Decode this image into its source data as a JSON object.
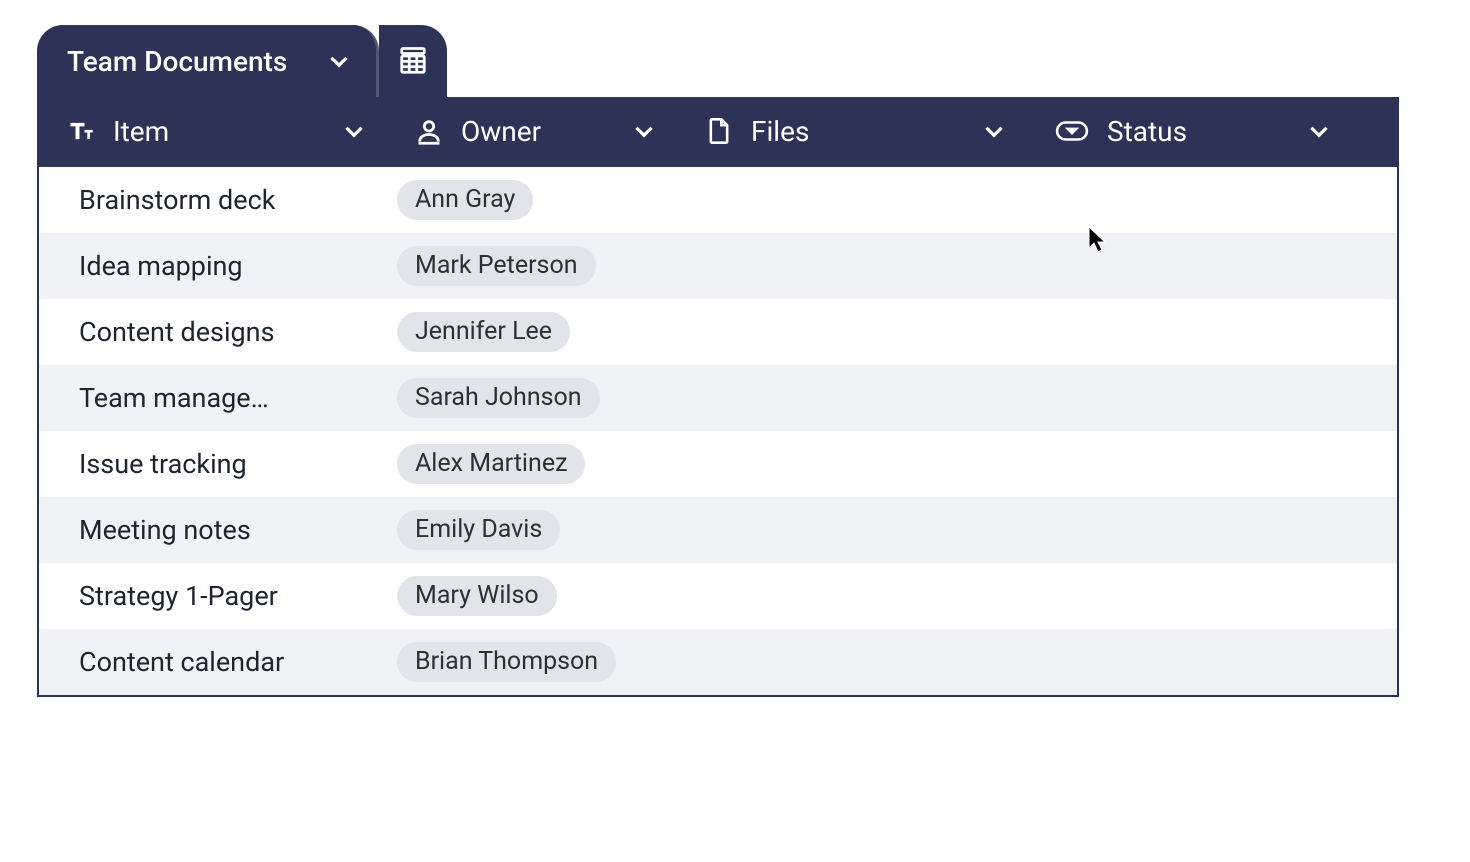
{
  "tab": {
    "title": "Team Documents"
  },
  "columns": {
    "item": {
      "label": "Item"
    },
    "owner": {
      "label": "Owner"
    },
    "files": {
      "label": "Files"
    },
    "status": {
      "label": "Status"
    }
  },
  "rows": [
    {
      "item": "Brainstorm deck",
      "owner": "Ann Gray"
    },
    {
      "item": "Idea mapping",
      "owner": "Mark Peterson"
    },
    {
      "item": "Content designs",
      "owner": "Jennifer Lee"
    },
    {
      "item": "Team manage…",
      "owner": "Sarah Johnson"
    },
    {
      "item": "Issue tracking",
      "owner": "Alex Martinez"
    },
    {
      "item": "Meeting notes",
      "owner": "Emily Davis"
    },
    {
      "item": "Strategy 1-Pager",
      "owner": "Mary Wilso"
    },
    {
      "item": "Content calendar",
      "owner": "Brian Thompson"
    }
  ],
  "colors": {
    "header_bg": "#2c3357",
    "row_alt_bg": "#f1f2f6",
    "pill_bg": "#e2e4ea"
  }
}
